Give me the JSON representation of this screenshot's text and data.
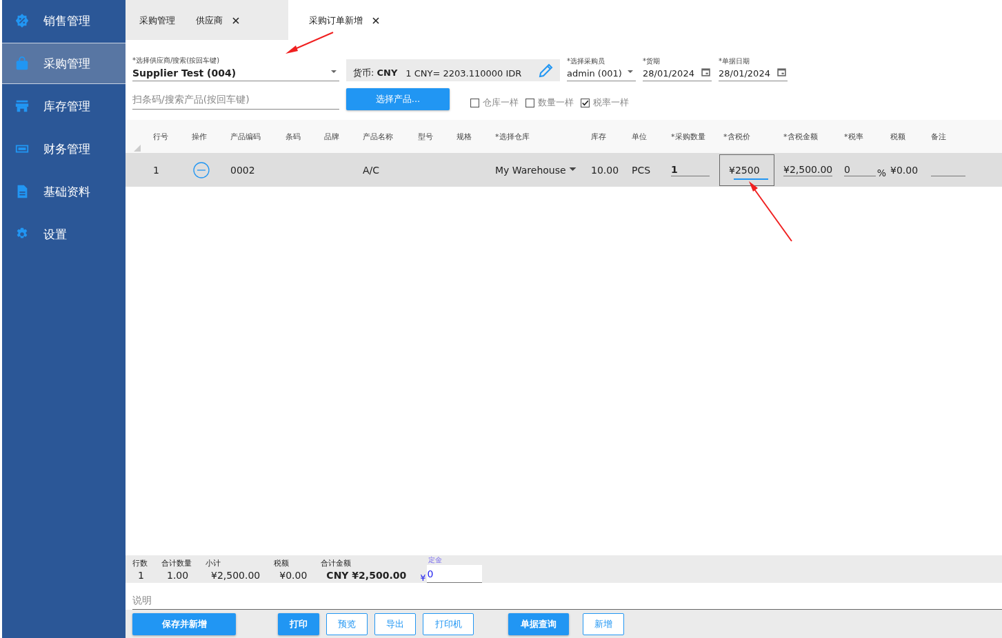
{
  "sidebar": {
    "items": [
      {
        "label": "销售管理",
        "selected": false
      },
      {
        "label": "采购管理",
        "selected": true
      },
      {
        "label": "库存管理",
        "selected": false
      },
      {
        "label": "财务管理",
        "selected": false
      },
      {
        "label": "基础资料",
        "selected": false
      },
      {
        "label": "设置",
        "selected": false
      }
    ]
  },
  "tabs": [
    {
      "label": "采购管理",
      "closable": false,
      "selected": false
    },
    {
      "label": "供应商",
      "closable": true,
      "selected": false
    },
    {
      "label": "采购订单新增",
      "closable": true,
      "selected": true
    }
  ],
  "form": {
    "supplier": {
      "label": "*选择供应商/搜索(按回车键)",
      "value": "Supplier Test (004)"
    },
    "currency": {
      "label": "货币:",
      "code": "CNY",
      "rate": "1 CNY=  2203.110000 IDR"
    },
    "buyer": {
      "label": "*选择采购员",
      "value": "admin (001)"
    },
    "delivery_date": {
      "label": "*货期",
      "value": "28/01/2024"
    },
    "document_date": {
      "label": "*单据日期",
      "value": "28/01/2024"
    },
    "product_search": {
      "placeholder": "扫条码/搜索产品(按回车键)"
    },
    "select_products_button": "选择产品...",
    "options": [
      {
        "label": "仓库一样",
        "checked": false
      },
      {
        "label": "数量一样",
        "checked": false
      },
      {
        "label": "税率一样",
        "checked": true
      }
    ]
  },
  "table": {
    "columns": [
      "行号",
      "操作",
      "产品编码",
      "条码",
      "品牌",
      "产品名称",
      "型号",
      "规格",
      "*选择仓库",
      "库存",
      "单位",
      "*采购数量",
      "*含税价",
      "*含税金额",
      "*税率",
      "税额",
      "备注"
    ],
    "rows": [
      {
        "line": "1",
        "code": "0002",
        "name": "A/C",
        "warehouse": "My Warehouse",
        "stock": "10.00",
        "unit": "PCS",
        "quantity": "1",
        "price": "¥2500",
        "amount": "¥2,500.00",
        "tax_rate": "0",
        "percent": "%",
        "tax": "¥0.00"
      }
    ]
  },
  "summary": {
    "items": [
      {
        "label": "行数",
        "value": "1",
        "bold": false
      },
      {
        "label": "合计数量",
        "value": "1.00",
        "bold": false
      },
      {
        "label": "小计",
        "value": "¥2,500.00",
        "bold": false
      },
      {
        "label": "税额",
        "value": "¥0.00",
        "bold": false
      },
      {
        "label": "合计金额",
        "value": "CNY ¥2,500.00",
        "bold": true
      }
    ],
    "deposit": {
      "label": "定金",
      "currency": "¥",
      "value": "0"
    }
  },
  "note": {
    "placeholder": "说明"
  },
  "buttons": [
    {
      "label": "保存并新增",
      "kind": "primary"
    },
    {
      "label": "打印",
      "kind": "primary"
    },
    {
      "label": "预览",
      "kind": "outline"
    },
    {
      "label": "导出",
      "kind": "outline"
    },
    {
      "label": "打印机",
      "kind": "outline"
    },
    {
      "label": "单据查询",
      "kind": "primary"
    },
    {
      "label": "新增",
      "kind": "outline"
    }
  ]
}
